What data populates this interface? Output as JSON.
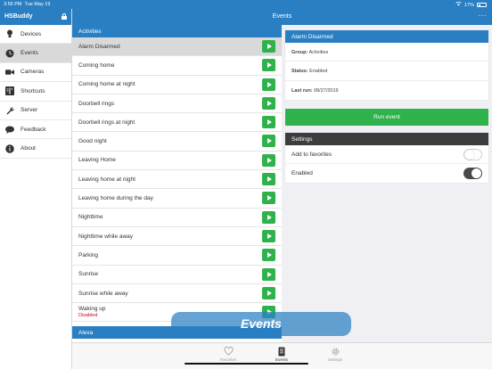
{
  "status_bar": {
    "time": "3:56 PM",
    "date": "Tue May 19",
    "battery": "17%"
  },
  "sidebar": {
    "title": "HSBuddy",
    "items": [
      {
        "label": "Devices",
        "icon": "bulb-icon"
      },
      {
        "label": "Events",
        "icon": "clock-icon"
      },
      {
        "label": "Cameras",
        "icon": "camera-icon"
      },
      {
        "label": "Shortcuts",
        "icon": "shortcuts-icon"
      },
      {
        "label": "Server",
        "icon": "wrench-icon"
      },
      {
        "label": "Feedback",
        "icon": "chat-icon"
      },
      {
        "label": "About",
        "icon": "info-icon"
      }
    ],
    "active_index": 1
  },
  "header": {
    "title": "Events",
    "menu": "···"
  },
  "activities": {
    "section_title": "Activities",
    "items": [
      {
        "label": "Alarm Disarmed",
        "sub": ""
      },
      {
        "label": "Coming home",
        "sub": ""
      },
      {
        "label": "Coming home at night",
        "sub": ""
      },
      {
        "label": "Doorbell rings",
        "sub": ""
      },
      {
        "label": "Doorbell rings at night",
        "sub": ""
      },
      {
        "label": "Good night",
        "sub": ""
      },
      {
        "label": "Leaving Home",
        "sub": ""
      },
      {
        "label": "Leaving home at night",
        "sub": ""
      },
      {
        "label": "Leaving home during the day",
        "sub": ""
      },
      {
        "label": "Nighttime",
        "sub": ""
      },
      {
        "label": "Nighttime while away",
        "sub": ""
      },
      {
        "label": "Parking",
        "sub": ""
      },
      {
        "label": "Sunrise",
        "sub": ""
      },
      {
        "label": "Sunrise while away",
        "sub": ""
      },
      {
        "label": "Waking up",
        "sub": "Disabled"
      }
    ],
    "selected_index": 0,
    "next_section_title": "Alexa"
  },
  "detail": {
    "title": "Alarm Disarmed",
    "group_label": "Group:",
    "group_value": "Activities",
    "status_label": "Status:",
    "status_value": "Enabled",
    "last_run_label": "Last run:",
    "last_run_value": "08/27/2019",
    "run_button": "Run event"
  },
  "settings": {
    "title": "Settings",
    "rows": [
      {
        "label": "Add to favorites",
        "on": false
      },
      {
        "label": "Enabled",
        "on": true
      }
    ]
  },
  "overlay_text": "Events",
  "tabs": [
    {
      "label": "Favorites",
      "icon": "heart-icon",
      "active": false
    },
    {
      "label": "Events",
      "icon": "list-icon",
      "active": true
    },
    {
      "label": "Settings",
      "icon": "gear-icon",
      "active": false
    }
  ],
  "colors": {
    "accent": "#2a7fc3",
    "play": "#2fb24c",
    "header_dark": "#3d3d3d",
    "disabled": "#d0021b"
  }
}
